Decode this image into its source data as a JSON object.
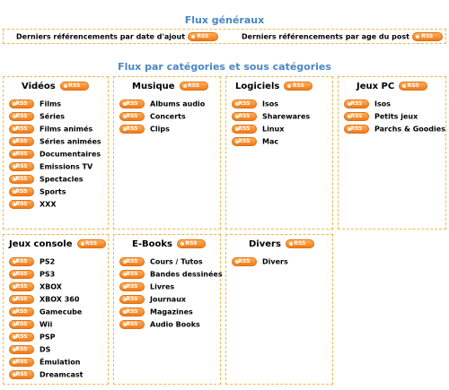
{
  "general": {
    "title": "Flux généraux",
    "items": [
      {
        "label": "Derniers référencements par date d'ajout",
        "badge": "RSS"
      },
      {
        "label": "Derniers référencements par age du post",
        "badge": "RSS"
      }
    ]
  },
  "categories_title": "Flux par catégories et sous catégories",
  "rss_badge": "RSS",
  "categories": [
    {
      "name": "Vidéos",
      "items": [
        "Films",
        "Séries",
        "Films animés",
        "Séries animées",
        "Documentaires",
        "Emissions TV",
        "Spectacles",
        "Sports",
        "XXX"
      ]
    },
    {
      "name": "Musique",
      "items": [
        "Albums audio",
        "Concerts",
        "Clips"
      ]
    },
    {
      "name": "Logiciels",
      "items": [
        "Isos",
        "Sharewares",
        "Linux",
        "Mac"
      ]
    },
    {
      "name": "Jeux PC",
      "items": [
        "Isos",
        "Petits jeux",
        "Parchs & Goodies"
      ]
    },
    {
      "name": "Jeux console",
      "items": [
        "PS2",
        "PS3",
        "XBOX",
        "XBOX 360",
        "Gamecube",
        "Wii",
        "PSP",
        "DS",
        "Émulation",
        "Dreamcast"
      ]
    },
    {
      "name": "E-Books",
      "items": [
        "Cours / Tutos",
        "Bandes dessinées",
        "Livres",
        "Journaux",
        "Magazines",
        "Audio Books"
      ]
    },
    {
      "name": "Divers",
      "items": [
        "Divers"
      ]
    }
  ],
  "colors": {
    "title": "#4a86c5",
    "border": "#f0b848",
    "rss": "#f07a1a"
  }
}
